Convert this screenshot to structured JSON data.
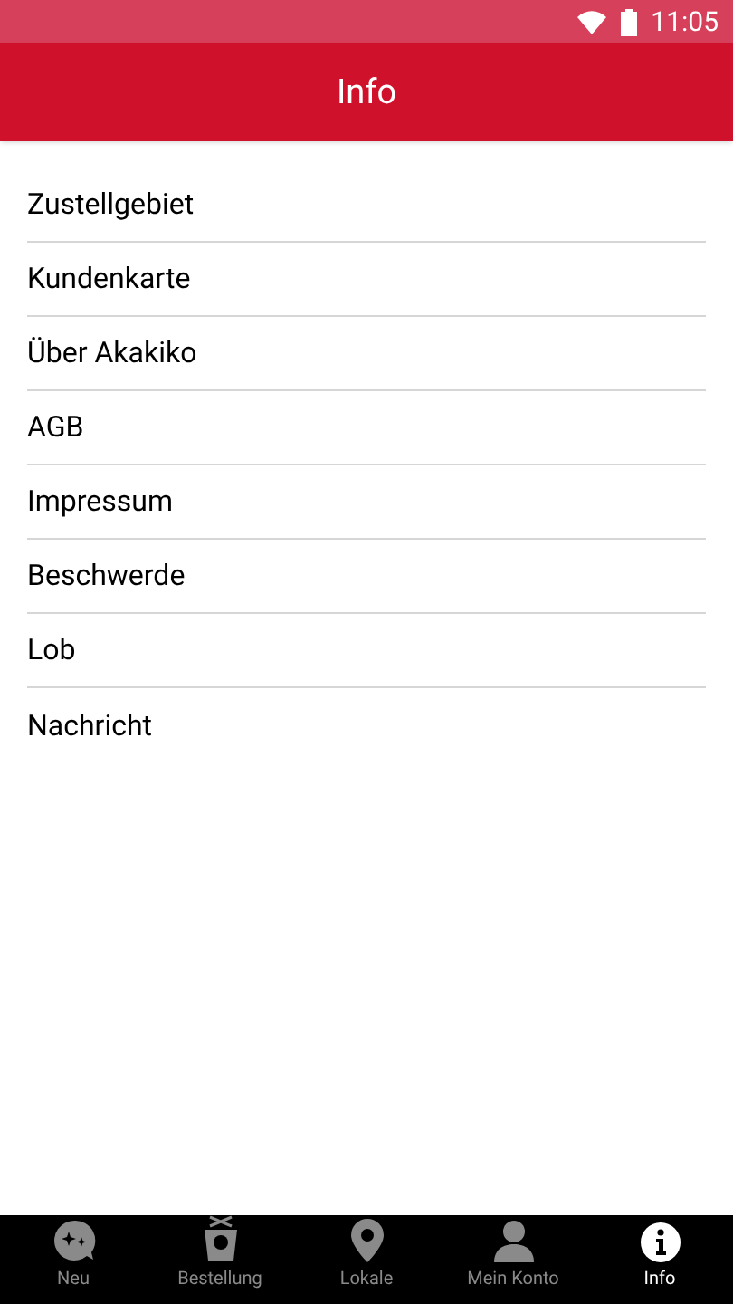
{
  "status_bar": {
    "time": "11:05"
  },
  "header": {
    "title": "Info"
  },
  "menu": [
    {
      "label": "Zustellgebiet"
    },
    {
      "label": "Kundenkarte"
    },
    {
      "label": "Über Akakiko"
    },
    {
      "label": "AGB"
    },
    {
      "label": "Impressum"
    },
    {
      "label": "Beschwerde"
    },
    {
      "label": "Lob"
    },
    {
      "label": "Nachricht"
    }
  ],
  "tabs": [
    {
      "label": "Neu",
      "kind": "news",
      "selected": false
    },
    {
      "label": "Bestellung",
      "kind": "order",
      "selected": false
    },
    {
      "label": "Lokale",
      "kind": "location",
      "selected": false
    },
    {
      "label": "Mein Konto",
      "kind": "account",
      "selected": false
    },
    {
      "label": "Info",
      "kind": "info",
      "selected": true
    }
  ]
}
